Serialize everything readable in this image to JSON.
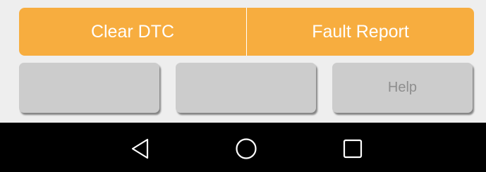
{
  "toolbar": {
    "clear_dtc_label": "Clear DTC",
    "fault_report_label": "Fault Report"
  },
  "secondary_buttons": {
    "button1_label": "",
    "button2_label": "",
    "help_label": "Help"
  },
  "nav_bar": {
    "icons": [
      "back-icon",
      "home-icon",
      "recent-apps-icon"
    ]
  },
  "colors": {
    "accent_orange": "#f7ad3f",
    "button_gray": "#cccccc",
    "background": "#eeeeee",
    "nav_background": "#000000"
  }
}
